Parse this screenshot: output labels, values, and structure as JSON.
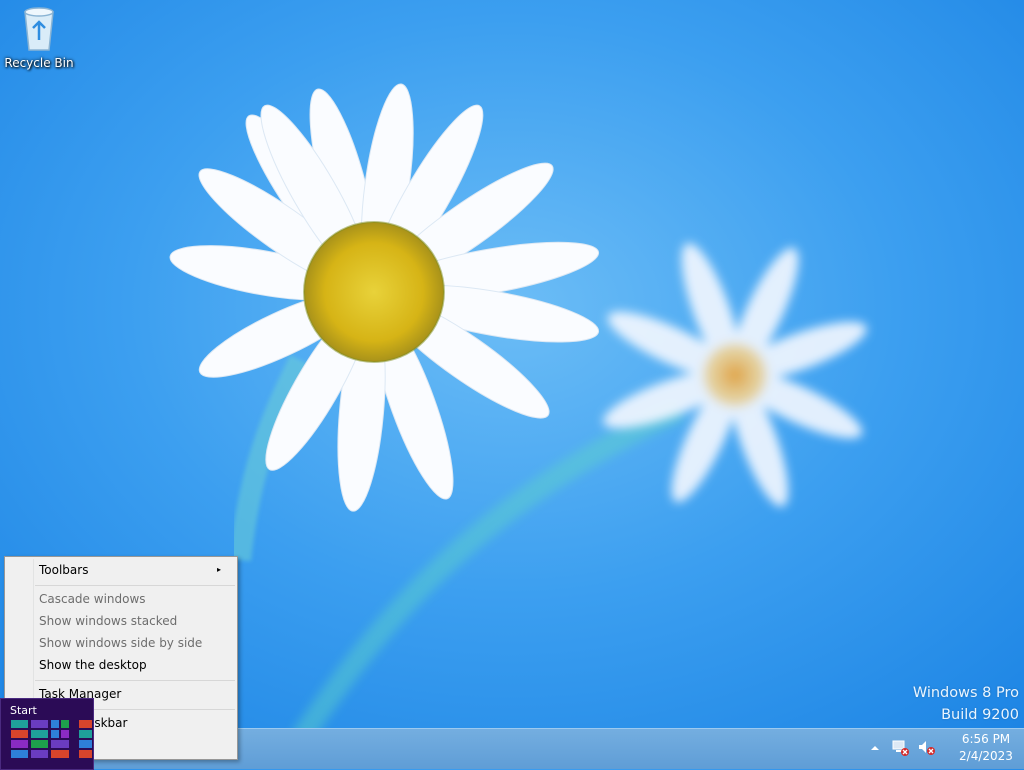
{
  "desktop": {
    "icons": [
      {
        "label": "Recycle Bin"
      }
    ],
    "watermark": {
      "line1": "Windows 8 Pro",
      "line2": "Build 9200"
    }
  },
  "context_menu": {
    "items": [
      {
        "label": "Toolbars",
        "enabled": true,
        "has_submenu": true
      },
      {
        "label": "Cascade windows",
        "enabled": false
      },
      {
        "label": "Show windows stacked",
        "enabled": false
      },
      {
        "label": "Show windows side by side",
        "enabled": false
      },
      {
        "label": "Show the desktop",
        "enabled": true
      },
      {
        "label": "Task Manager",
        "enabled": true
      },
      {
        "label": "askbar",
        "enabled": true
      }
    ],
    "submenu_arrow": "▸"
  },
  "start_thumbnail": {
    "title": "Start"
  },
  "tray": {
    "icons": [
      "show-hidden-icons-arrow",
      "network-disconnected-icon",
      "volume-muted-icon"
    ],
    "time": "6:56 PM",
    "date": "2/4/2023"
  },
  "colors": {
    "wallpaper_blue": "#3a9df0",
    "taskbar": "#6aa6dc",
    "start_bg": "#2b0b56",
    "menu_bg": "#f0f0f0"
  }
}
